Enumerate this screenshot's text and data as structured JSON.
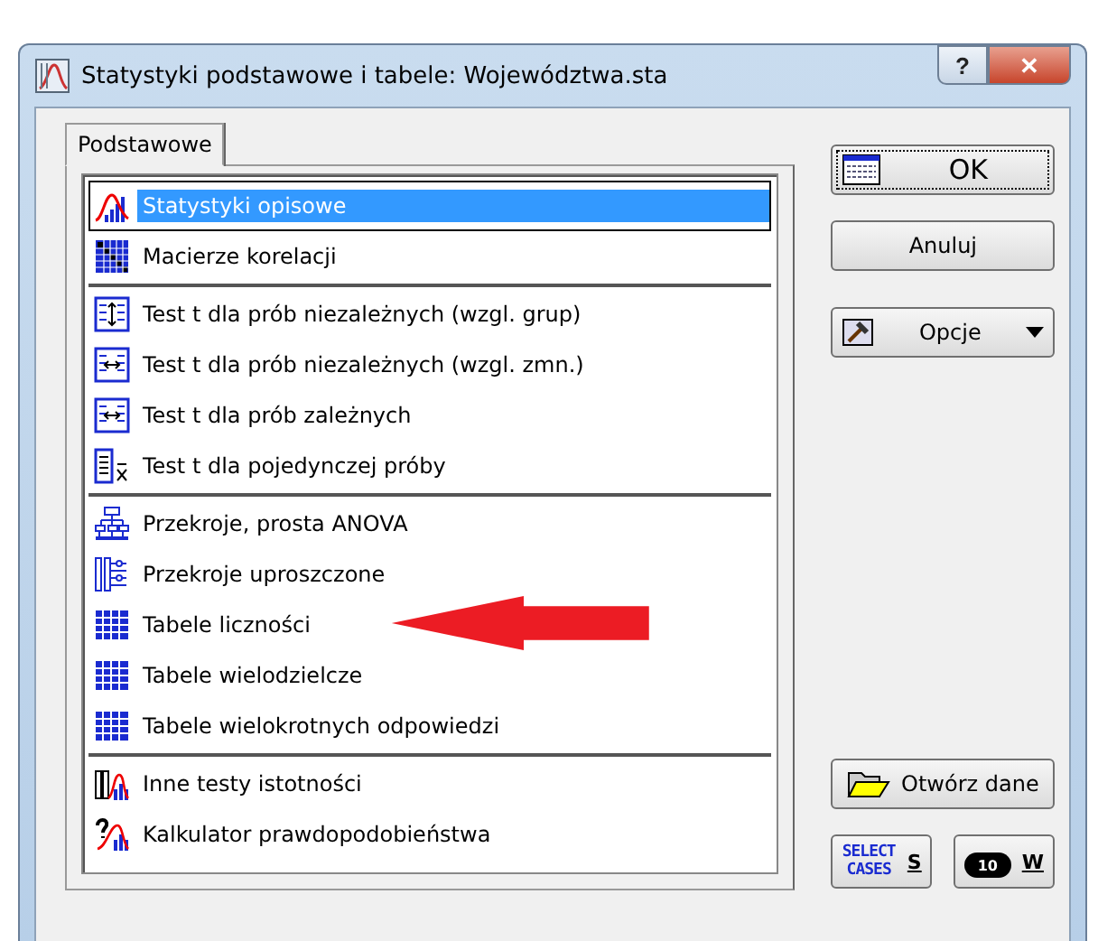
{
  "window": {
    "title": "Statystyki podstawowe i tabele: Województwa.sta",
    "help_button": "?",
    "close_button": "✕"
  },
  "tabs": [
    {
      "label": "Podstawowe",
      "selected": true
    }
  ],
  "list": {
    "groups": [
      {
        "items": [
          {
            "label": "Statystyki opisowe",
            "selected": true,
            "arrow": false
          },
          {
            "label": "Macierze korelacji",
            "selected": false,
            "arrow": false
          }
        ]
      },
      {
        "items": [
          {
            "label": "Test t dla prób niezależnych (wzgl. grup)",
            "selected": false,
            "arrow": false
          },
          {
            "label": "Test t dla prób niezależnych (wzgl. zmn.)",
            "selected": false,
            "arrow": false
          },
          {
            "label": "Test t dla prób zależnych",
            "selected": false,
            "arrow": false
          },
          {
            "label": "Test t dla pojedynczej próby",
            "selected": false,
            "arrow": false
          }
        ]
      },
      {
        "items": [
          {
            "label": "Przekroje, prosta ANOVA",
            "selected": false,
            "arrow": false
          },
          {
            "label": "Przekroje uproszczone",
            "selected": false,
            "arrow": false
          },
          {
            "label": "Tabele liczności",
            "selected": false,
            "arrow": true
          },
          {
            "label": "Tabele wielodzielcze",
            "selected": false,
            "arrow": false
          },
          {
            "label": "Tabele wielokrotnych odpowiedzi",
            "selected": false,
            "arrow": false
          }
        ]
      },
      {
        "items": [
          {
            "label": "Inne testy istotności",
            "selected": false,
            "arrow": false
          },
          {
            "label": "Kalkulator prawdopodobieństwa",
            "selected": false,
            "arrow": false
          }
        ]
      }
    ]
  },
  "buttons": {
    "ok": "OK",
    "cancel": "Anuluj",
    "options": "Opcje",
    "open_data": "Otwórz dane",
    "select_cases_icon": [
      "SELECT",
      "CASES"
    ],
    "select_cases_key": "S",
    "weight_icon": "10",
    "weight_key": "W"
  }
}
